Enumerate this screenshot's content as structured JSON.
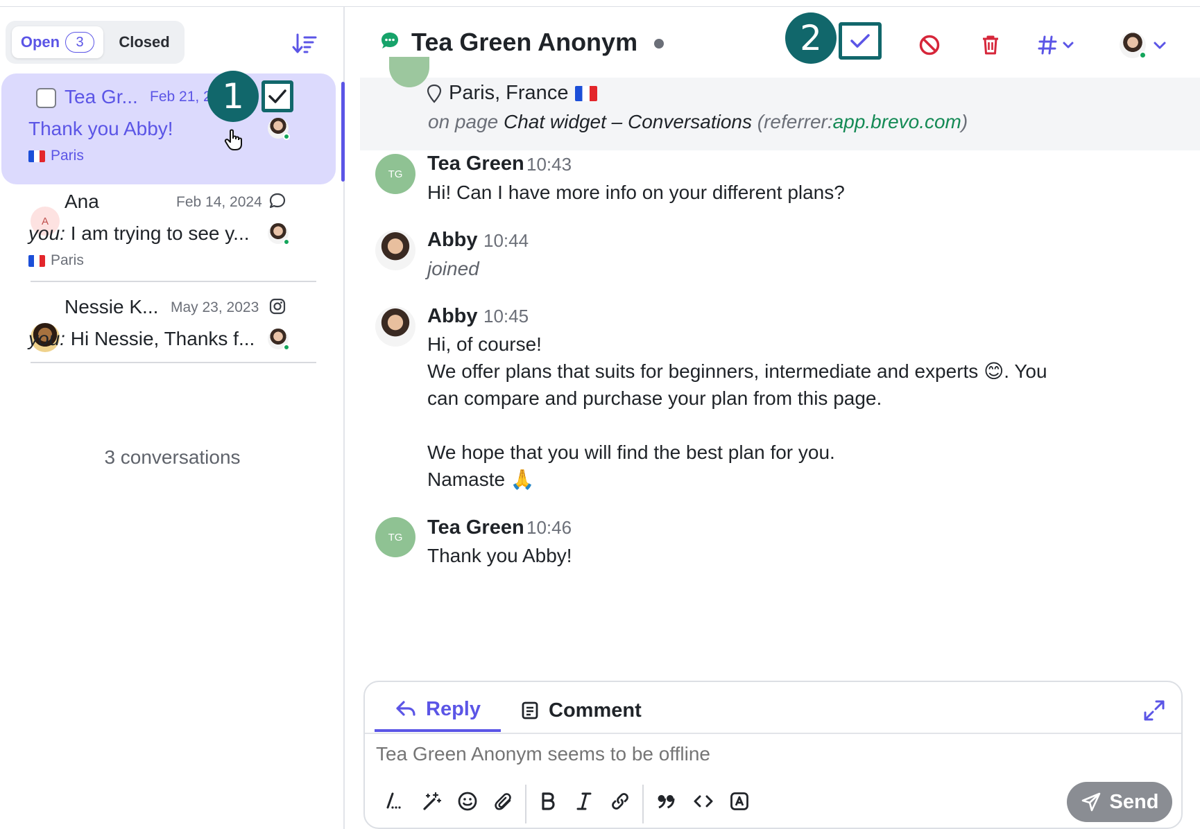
{
  "sidebar": {
    "tabs": {
      "open_label": "Open",
      "open_count": "3",
      "closed_label": "Closed"
    },
    "conversations": [
      {
        "name": "Tea Gr...",
        "date": "Feb 21, 2",
        "preview": "Thank you Abby!",
        "location": "Paris",
        "active": true
      },
      {
        "name": "Ana",
        "date": "Feb 14, 2024",
        "preview_prefix": "you:",
        "preview": "I am trying to see y...",
        "location": "Paris",
        "initial": "A"
      },
      {
        "name": "Nessie K...",
        "date": "May 23, 2023",
        "preview_prefix": "you:",
        "preview": "Hi Nessie, Thanks f..."
      }
    ],
    "count_label": "3 conversations"
  },
  "annotations": {
    "badge1": "1",
    "badge2": "2"
  },
  "header": {
    "title": "Tea Green Anonym"
  },
  "visitor_info": {
    "location": "Paris, France",
    "page_prefix": "on page",
    "page_name": "Chat widget – Conversations",
    "referrer_prefix": "(referrer:",
    "referrer_domain": "app.brevo.com",
    "referrer_suffix": ")"
  },
  "messages": [
    {
      "author": "Tea Green",
      "initials": "TG",
      "time": "10:43",
      "lines": [
        "Hi! Can I have more info on your different plans?"
      ]
    },
    {
      "author": "Abby",
      "time": "10:44",
      "lines": [
        "joined"
      ]
    },
    {
      "author": "Abby",
      "time": "10:45",
      "lines": [
        "Hi, of course!",
        "We offer plans that suits for beginners, intermediate and experts 😊. You",
        "can compare and purchase your plan from this page.",
        "We hope that you will find the best plan for you.",
        "Namaste 🙏"
      ]
    },
    {
      "author": "Tea Green",
      "initials": "TG",
      "time": "10:46",
      "lines": [
        "Thank you Abby!"
      ]
    }
  ],
  "composer": {
    "reply_tab": "Reply",
    "comment_tab": "Comment",
    "placeholder": "Tea Green Anonym seems to be offline",
    "send_label": "Send"
  },
  "colors": {
    "accent": "#5b55e6",
    "annotation": "#11676b",
    "danger": "#d6263a",
    "online": "#14a55b"
  }
}
